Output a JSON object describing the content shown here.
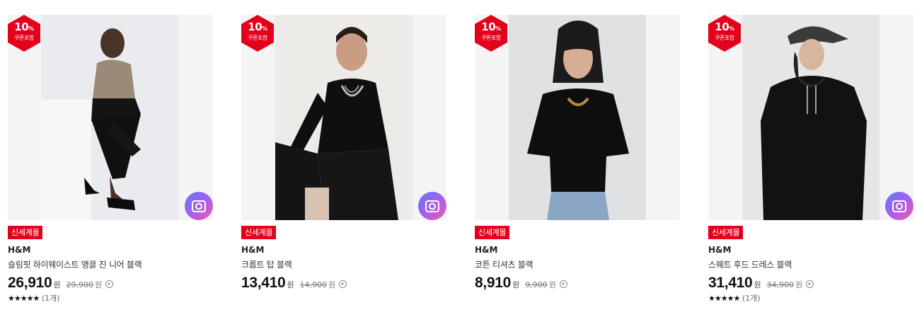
{
  "colors": {
    "coupon_red": "#e3001b",
    "badge_red": "#e3001b"
  },
  "products": [
    {
      "coupon_percent": "10",
      "coupon_percent_sign": "%",
      "coupon_label": "쿠폰포함",
      "badge": "신세계몰",
      "brand": "H&M",
      "name": "슬림핏 하이웨이스트 앵클 진 니어 블랙",
      "price": "26,910",
      "currency": "원",
      "original_price": "29,900",
      "original_currency": "원",
      "stars": "★★★★★",
      "review_count": "(1개)",
      "image_icon": "camera-icon"
    },
    {
      "coupon_percent": "10",
      "coupon_percent_sign": "%",
      "coupon_label": "쿠폰포함",
      "badge": "신세계몰",
      "brand": "H&M",
      "name": "크롭트 탑 블랙",
      "price": "13,410",
      "currency": "원",
      "original_price": "14,900",
      "original_currency": "원",
      "image_icon": "camera-icon"
    },
    {
      "coupon_percent": "10",
      "coupon_percent_sign": "%",
      "coupon_label": "쿠폰포함",
      "badge": "신세계몰",
      "brand": "H&M",
      "name": "코튼 티셔츠 블랙",
      "price": "8,910",
      "currency": "원",
      "original_price": "9,900",
      "original_currency": "원",
      "image_icon": "camera-icon"
    },
    {
      "coupon_percent": "10",
      "coupon_percent_sign": "%",
      "coupon_label": "쿠폰포함",
      "badge": "신세계몰",
      "brand": "H&M",
      "name": "스웨트 후드 드레스 블랙",
      "price": "31,410",
      "currency": "원",
      "original_price": "34,900",
      "original_currency": "원",
      "stars": "★★★★★",
      "review_count": "(1개)",
      "image_icon": "camera-icon"
    }
  ]
}
